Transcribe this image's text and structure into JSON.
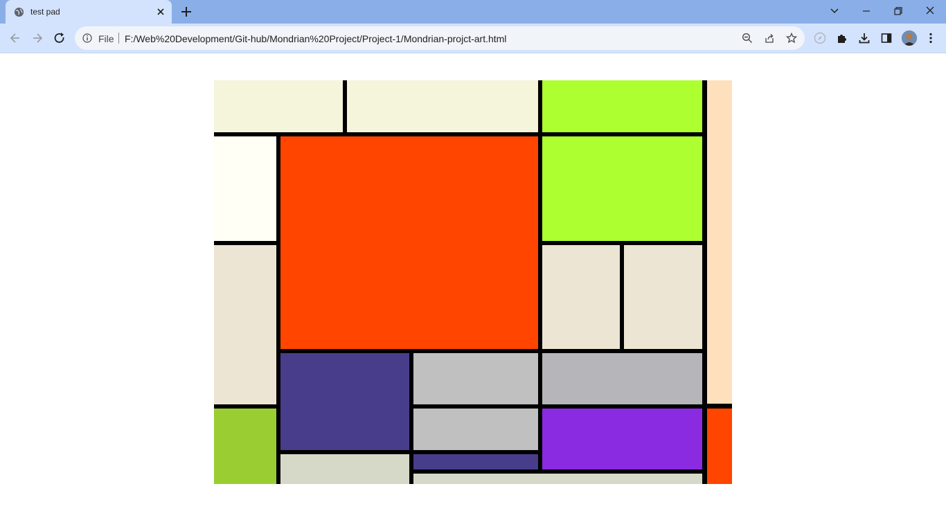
{
  "browser": {
    "tab": {
      "title": "test pad",
      "favicon": "globe-icon"
    },
    "address": {
      "scheme_label": "File",
      "url": "F:/Web%20Development/Git-hub/Mondrian%20Project/Project-1/Mondrian-projct-art.html"
    }
  },
  "artwork": {
    "colors": {
      "beige": "#f5f5dc",
      "greenyellow": "#adff2f",
      "ivory": "#fffff5",
      "orangered": "#ff4500",
      "linen": "#ece5d3",
      "bisque": "#ffe0bd",
      "darkslateblue": "#483d8b",
      "silver": "#c0c0c0",
      "grey": "#b6b6ba",
      "yellowgreen": "#9acd32",
      "blueviolet": "#8a2be2",
      "pale": "#d6d9c8",
      "border": "#000000"
    }
  }
}
